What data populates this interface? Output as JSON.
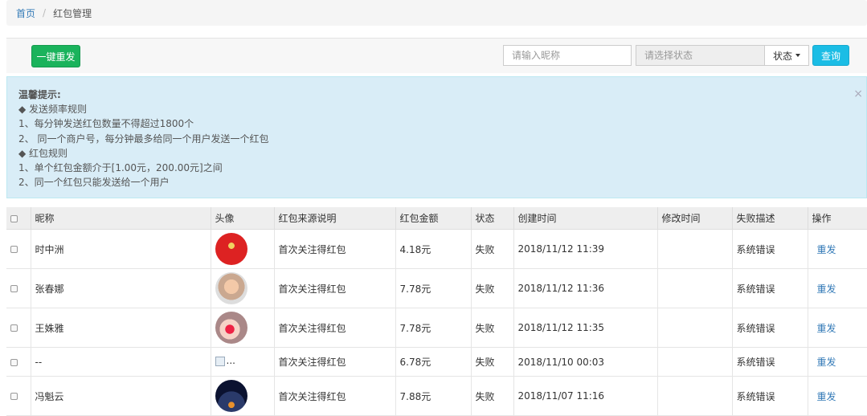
{
  "breadcrumb": {
    "home": "首页",
    "separator": "/",
    "current": "红包管理"
  },
  "toolbar": {
    "resend_all_label": "一键重发",
    "nickname_placeholder": "请输入昵称",
    "status_placeholder": "请选择状态",
    "status_dropdown_label": "状态",
    "query_label": "查询"
  },
  "alert": {
    "title": "温馨提示:",
    "lines": [
      "◆ 发送频率规则",
      "1、每分钟发送红包数量不得超过1800个",
      "2、 同一个商户号，每分钟最多给同一个用户发送一个红包",
      "◆ 红包规则",
      "1、单个红包金额介于[1.00元，200.00元]之间",
      "2、同一个红包只能发送给一个用户"
    ],
    "close": "×"
  },
  "table": {
    "headers": [
      "昵称",
      "头像",
      "红包来源说明",
      "红包金额",
      "状态",
      "创建时间",
      "修改时间",
      "失败描述",
      "操作"
    ],
    "rows": [
      {
        "nickname": "时中洲",
        "avatar": "avatar-red-new-year",
        "source": "首次关注得红包",
        "amount": "4.18元",
        "status": "失败",
        "created": "2018/11/12 11:39",
        "modified": "",
        "fail_desc": "系统错误",
        "action": "重发"
      },
      {
        "nickname": "张春娜",
        "avatar": "avatar-portrait-woman",
        "source": "首次关注得红包",
        "amount": "7.78元",
        "status": "失败",
        "created": "2018/11/12 11:36",
        "modified": "",
        "fail_desc": "系统错误",
        "action": "重发"
      },
      {
        "nickname": "王姝雅",
        "avatar": "avatar-portrait-child",
        "source": "首次关注得红包",
        "amount": "7.78元",
        "status": "失败",
        "created": "2018/11/12 11:35",
        "modified": "",
        "fail_desc": "系统错误",
        "action": "重发"
      },
      {
        "nickname": "--",
        "avatar": "broken-image",
        "avatar_alt": "...",
        "source": "首次关注得红包",
        "amount": "6.78元",
        "status": "失败",
        "created": "2018/11/10 00:03",
        "modified": "",
        "fail_desc": "系统错误",
        "action": "重发"
      },
      {
        "nickname": "冯魁云",
        "avatar": "avatar-sunset-landscape",
        "source": "首次关注得红包",
        "amount": "7.88元",
        "status": "失败",
        "created": "2018/11/07 11:16",
        "modified": "",
        "fail_desc": "系统错误",
        "action": "重发"
      }
    ]
  }
}
